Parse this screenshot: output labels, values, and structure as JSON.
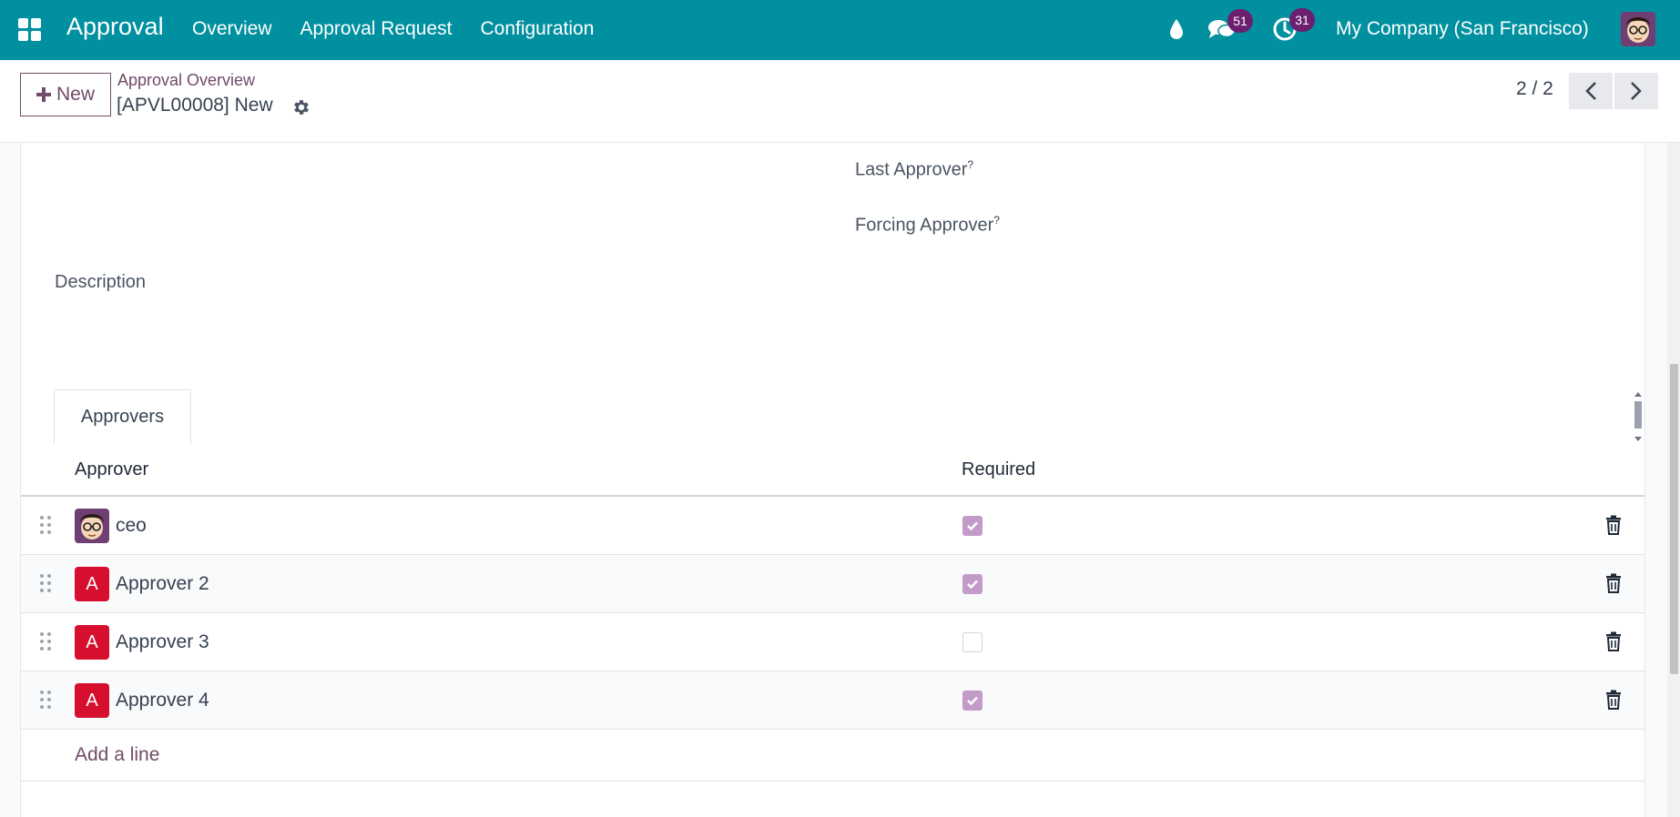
{
  "navbar": {
    "app_title": "Approval",
    "menu": [
      "Overview",
      "Approval Request",
      "Configuration"
    ],
    "messages_badge": "51",
    "activities_badge": "31",
    "company": "My Company (San Francisco)",
    "bg_color": "#00909f"
  },
  "control_panel": {
    "new_label": "New",
    "breadcrumb": "Approval Overview",
    "record_title": "[APVL00008] New",
    "pager": "2 / 2"
  },
  "form": {
    "last_approver_label": "Last Approver",
    "forcing_approver_label": "Forcing Approver",
    "help_mark": "?",
    "description_label": "Description"
  },
  "tabs": {
    "active": "Approvers"
  },
  "table": {
    "columns": [
      "Approver",
      "Required"
    ],
    "rows": [
      {
        "name": "ceo",
        "avatar": "photo",
        "required": true
      },
      {
        "name": "Approver 2",
        "avatar": "A",
        "required": true
      },
      {
        "name": "Approver 3",
        "avatar": "A",
        "required": false
      },
      {
        "name": "Approver 4",
        "avatar": "A",
        "required": true
      }
    ],
    "add_line": "Add a line"
  },
  "colors": {
    "accent": "#714b67",
    "checkbox_on": "#c29bc8",
    "letter_avatar": "#d60f2f",
    "badge": "#6b1f6e"
  },
  "icons": [
    "apps-icon",
    "droplet-icon",
    "chat-icon",
    "clock-icon",
    "gear-icon",
    "chevron-left-icon",
    "chevron-right-icon",
    "drag-handle-icon",
    "trash-icon",
    "check-icon"
  ]
}
